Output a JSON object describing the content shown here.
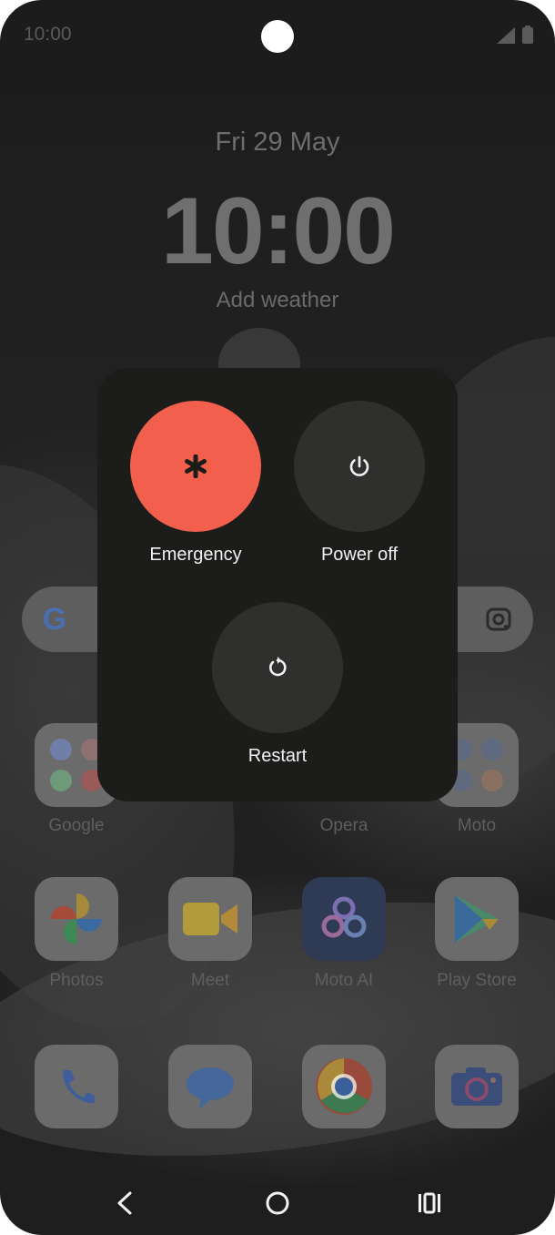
{
  "status_bar": {
    "time": "10:00",
    "icons": [
      "signal-icon",
      "battery-icon"
    ]
  },
  "lock_screen": {
    "date": "Fri 29 May",
    "clock": "10:00",
    "weather_prompt": "Add weather"
  },
  "search_bar": {
    "icons": [
      "google-logo-icon",
      "lens-icon"
    ]
  },
  "home_apps": {
    "row1": [
      {
        "label": "Google",
        "icon": "google-folder-icon"
      },
      {
        "label": "Opera",
        "icon": "opera-icon"
      },
      {
        "label": "Moto",
        "icon": "moto-folder-icon"
      }
    ],
    "row2": [
      {
        "label": "Photos",
        "icon": "photos-icon"
      },
      {
        "label": "Meet",
        "icon": "meet-icon"
      },
      {
        "label": "Moto AI",
        "icon": "moto-ai-icon"
      },
      {
        "label": "Play Store",
        "icon": "play-store-icon"
      }
    ],
    "dock": [
      "phone-icon",
      "messages-icon",
      "chrome-icon",
      "camera-icon"
    ]
  },
  "power_menu": {
    "emergency": {
      "label": "Emergency",
      "icon": "asterisk-icon",
      "color": "#f2604d"
    },
    "power_off": {
      "label": "Power off",
      "icon": "power-icon"
    },
    "restart": {
      "label": "Restart",
      "icon": "restart-icon"
    },
    "button_color": "#2f2f2e",
    "panel_color": "#1c1d1a"
  },
  "navigation": [
    "back-icon",
    "home-icon",
    "recents-icon"
  ]
}
